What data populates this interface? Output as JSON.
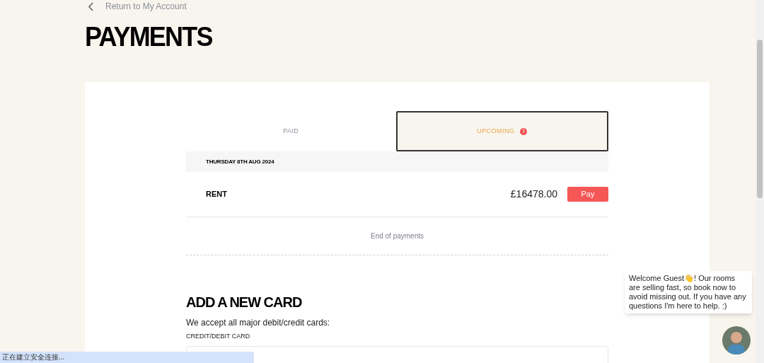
{
  "back_link": {
    "label": "Return to My Account"
  },
  "title": "PAYMENTS",
  "tabs": [
    {
      "label": "PAID",
      "selected": false
    },
    {
      "label": "UPCOMING",
      "selected": true,
      "badge": "1"
    }
  ],
  "date_header": "THURSDAY 8TH AUG 2024",
  "payments": [
    {
      "name": "RENT",
      "amount": "£16478.00",
      "action": "Pay"
    }
  ],
  "end_note": "End of payments",
  "add_card": {
    "title": "ADD A NEW CARD",
    "subtitle": "We accept all major debit/credit cards:",
    "field_label": "CREDIT/DEBIT CARD"
  },
  "chat": {
    "message": "Welcome Guest👋! Our rooms are selling fast, so book now to avoid missing out. If you have any questions I'm here to help. :)"
  },
  "status_bar": "正在建立安全连接..."
}
